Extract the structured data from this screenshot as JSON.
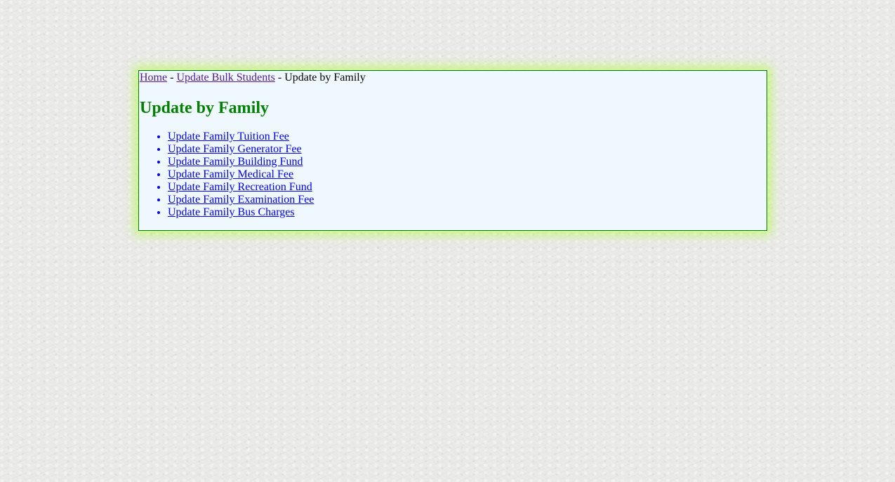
{
  "breadcrumb": {
    "home": "Home",
    "separator1": " - ",
    "bulk_students": "Update Bulk Students",
    "separator2": " - ",
    "current": "Update by Family"
  },
  "page": {
    "title": "Update by Family"
  },
  "links": [
    "Update Family Tuition Fee",
    "Update Family Generator Fee",
    "Update Family Building Fund",
    "Update Family Medical Fee",
    "Update Family Recreation Fund",
    "Update Family Examination Fee",
    "Update Family Bus Charges"
  ]
}
